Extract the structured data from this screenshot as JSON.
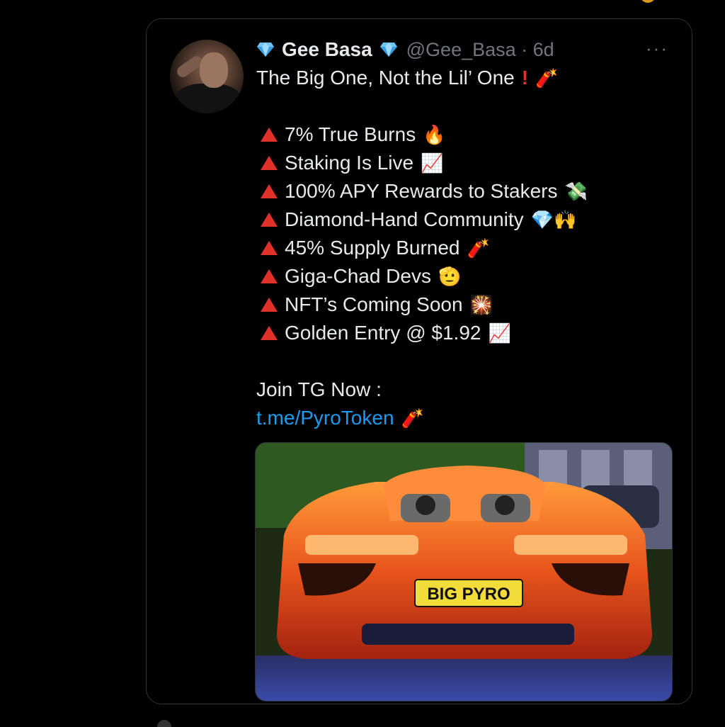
{
  "tweet": {
    "display_name": "Gee Basa",
    "handle_time": "@Gee_Basa · 6d",
    "more_label": "···",
    "headline": "The Big One, Not the Lil’ One",
    "items": [
      {
        "text": "7% True Burns",
        "emoji": "🔥"
      },
      {
        "text": "Staking Is Live",
        "emoji": "📈"
      },
      {
        "text": "100% APY Rewards to Stakers",
        "emoji": "💸"
      },
      {
        "text": "Diamond-Hand Community",
        "emoji": "💎🙌"
      },
      {
        "text": "45% Supply Burned",
        "emoji": "🧨"
      },
      {
        "text": "Giga-Chad Devs",
        "emoji": "🫡"
      },
      {
        "text": "NFT’s Coming Soon",
        "emoji": "🎇"
      },
      {
        "text": "Golden Entry @ $1.92",
        "emoji": "📈"
      }
    ],
    "cta": "Join TG Now :",
    "link": "t.me/PyroToken",
    "link_emoji": "🧨",
    "headline_emoji": "🧨",
    "image": {
      "plate_text": "BIG PYRO"
    }
  },
  "colors": {
    "background": "#000000",
    "text": "#e7e9ea",
    "muted": "#71767b",
    "link": "#1d9bf0",
    "bullet": "#e0312b"
  }
}
